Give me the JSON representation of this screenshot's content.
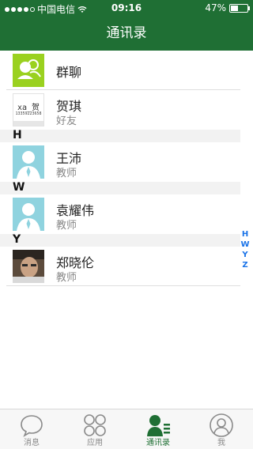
{
  "status_bar": {
    "carrier": "中国电信",
    "time": "09:16",
    "battery": "47%",
    "battery_level": 0.47
  },
  "nav": {
    "title": "通讯录"
  },
  "contacts": {
    "group_chat": {
      "name": "群聊"
    },
    "top": {
      "name": "贺琪",
      "subtitle": "好友",
      "avatar_line1": "xa_贺",
      "avatar_line2": "13359223658"
    },
    "sections": [
      {
        "letter": "H",
        "items": [
          {
            "name": "王沛",
            "subtitle": "教师"
          }
        ]
      },
      {
        "letter": "W",
        "items": [
          {
            "name": "袁耀伟",
            "subtitle": "教师"
          }
        ]
      },
      {
        "letter": "Y",
        "items": [
          {
            "name": "郑晓伦",
            "subtitle": "教师"
          }
        ]
      }
    ]
  },
  "index_bar": [
    "H",
    "W",
    "Y",
    "Z"
  ],
  "tabs": [
    {
      "label": "消息",
      "icon": "chat-bubble-icon"
    },
    {
      "label": "应用",
      "icon": "apps-grid-icon"
    },
    {
      "label": "通讯录",
      "icon": "contacts-icon",
      "active": true
    },
    {
      "label": "我",
      "icon": "profile-icon"
    }
  ],
  "colors": {
    "brand": "#1f6f34",
    "index": "#1a73e8",
    "group_avatar": "#9ad11f",
    "default_avatar": "#8fd3df"
  }
}
